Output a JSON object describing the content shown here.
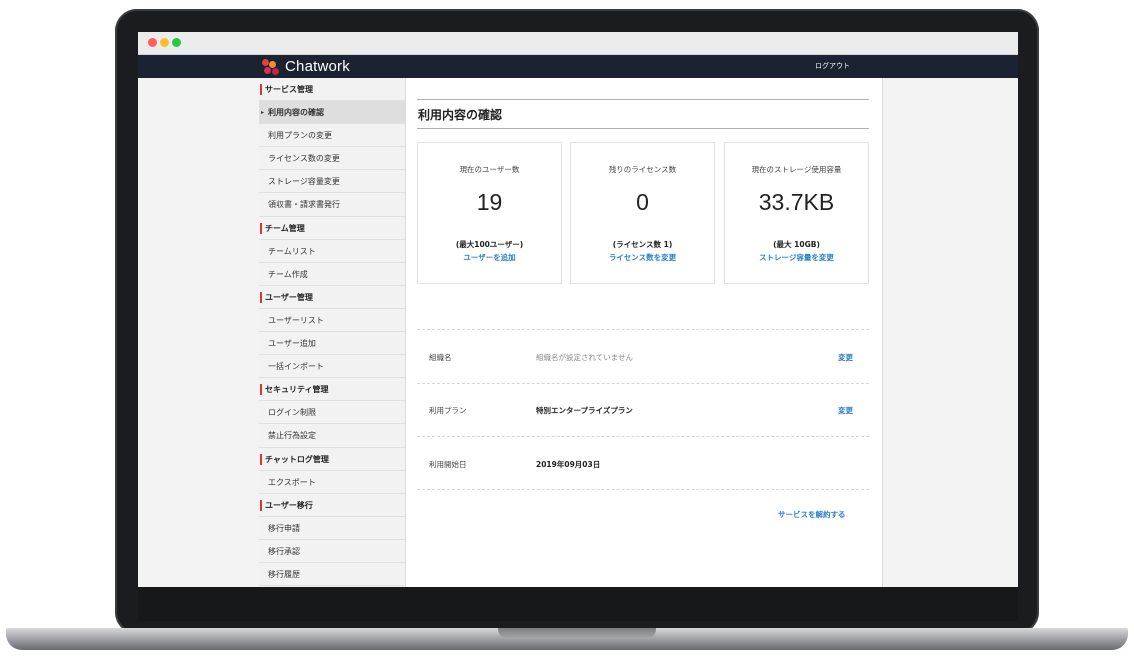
{
  "header": {
    "brand": "Chatwork",
    "logout": "ログアウト"
  },
  "sidebar": {
    "rows": [
      {
        "type": "head",
        "label": "サービス管理"
      },
      {
        "type": "active",
        "label": "利用内容の確認"
      },
      {
        "type": "item",
        "label": "利用プランの変更"
      },
      {
        "type": "item",
        "label": "ライセンス数の変更"
      },
      {
        "type": "item",
        "label": "ストレージ容量変更"
      },
      {
        "type": "item",
        "label": "領収書・請求書発行"
      },
      {
        "type": "head",
        "label": "チーム管理"
      },
      {
        "type": "item",
        "label": "チームリスト"
      },
      {
        "type": "item",
        "label": "チーム作成"
      },
      {
        "type": "head",
        "label": "ユーザー管理"
      },
      {
        "type": "item",
        "label": "ユーザーリスト"
      },
      {
        "type": "item",
        "label": "ユーザー追加"
      },
      {
        "type": "item",
        "label": "一括インポート"
      },
      {
        "type": "head",
        "label": "セキュリティ管理"
      },
      {
        "type": "item",
        "label": "ログイン制限"
      },
      {
        "type": "item",
        "label": "禁止行為設定"
      },
      {
        "type": "head",
        "label": "チャットログ管理"
      },
      {
        "type": "item",
        "label": "エクスポート"
      },
      {
        "type": "head",
        "label": "ユーザー移行"
      },
      {
        "type": "item",
        "label": "移行申請"
      },
      {
        "type": "item",
        "label": "移行承認"
      },
      {
        "type": "item",
        "label": "移行履歴"
      }
    ]
  },
  "main": {
    "title": "利用内容の確認",
    "cards": [
      {
        "label": "現在のユーザー数",
        "value": "19",
        "sub": "(最大100ユーザー)",
        "link": "ユーザーを追加"
      },
      {
        "label": "残りのライセンス数",
        "value": "0",
        "sub": "(ライセンス数 1)",
        "link": "ライセンス数を変更"
      },
      {
        "label": "現在のストレージ使用容量",
        "value": "33.7KB",
        "sub": "(最大 10GB)",
        "link": "ストレージ容量を変更"
      }
    ],
    "info": {
      "org_label": "組織名",
      "org_value": "組織名が設定されていません",
      "org_link": "変更",
      "plan_label": "利用プラン",
      "plan_value": "特別エンタープライズプラン",
      "plan_link": "変更",
      "start_label": "利用開始日",
      "start_value": "2019年09月03日"
    },
    "cancel_link": "サービスを解約する"
  },
  "colors": {
    "header_bg": "#1b2333",
    "accent_bar": "#d23a3a",
    "link": "#2a7fc7"
  }
}
